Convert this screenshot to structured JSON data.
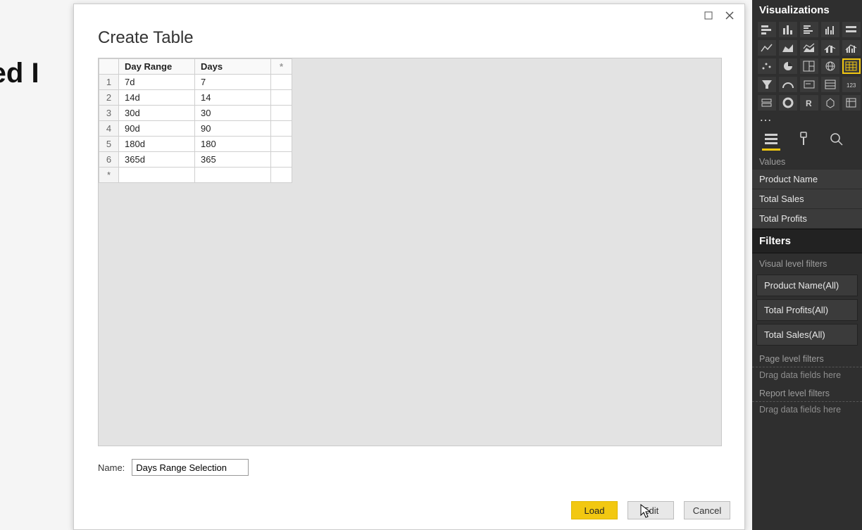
{
  "background": {
    "title_fragment": "aded I"
  },
  "dialog": {
    "title": "Create Table",
    "columns": {
      "range": "Day Range",
      "days": "Days",
      "star": "*"
    },
    "rows": [
      {
        "n": "1",
        "range": "7d",
        "days": "7"
      },
      {
        "n": "2",
        "range": "14d",
        "days": "14"
      },
      {
        "n": "3",
        "range": "30d",
        "days": "30"
      },
      {
        "n": "4",
        "range": "90d",
        "days": "90"
      },
      {
        "n": "5",
        "range": "180d",
        "days": "180"
      },
      {
        "n": "6",
        "range": "365d",
        "days": "365"
      }
    ],
    "name_label": "Name:",
    "name_value": "Days Range Selection",
    "buttons": {
      "load": "Load",
      "edit": "Edit",
      "cancel": "Cancel"
    }
  },
  "side": {
    "heading": "Visualizations",
    "values_label": "Values",
    "values": [
      "Product Name",
      "Total Sales",
      "Total Profits"
    ],
    "filters_heading": "Filters",
    "visual_filters_label": "Visual level filters",
    "visual_filters": [
      "Product Name(All)",
      "Total Profits(All)",
      "Total Sales(All)"
    ],
    "page_filters_label": "Page level filters",
    "report_filters_label": "Report level filters",
    "drag_hint": "Drag data fields here"
  }
}
